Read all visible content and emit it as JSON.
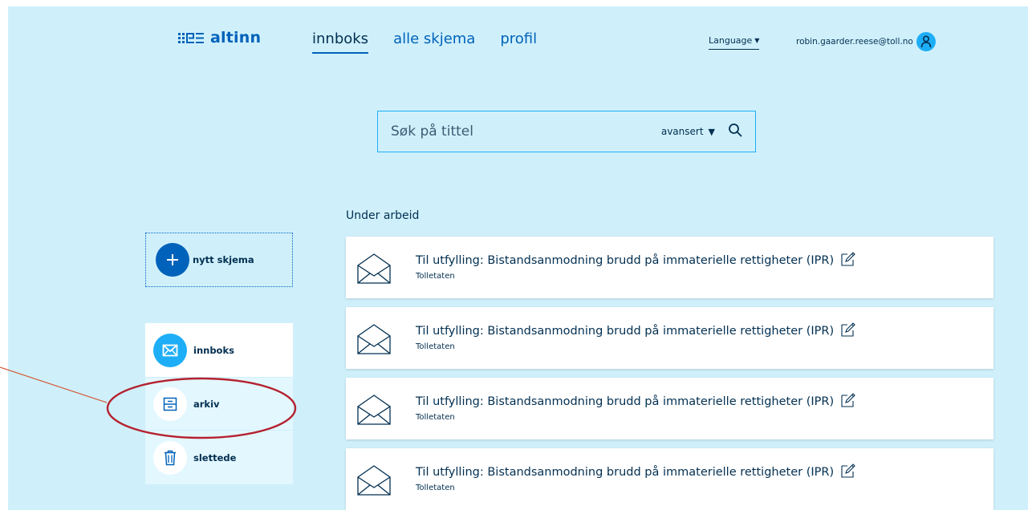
{
  "header": {
    "logo_text": "altinn",
    "nav": [
      {
        "label": "innboks",
        "active": true
      },
      {
        "label": "alle skjema",
        "active": false
      },
      {
        "label": "profil",
        "active": false
      }
    ],
    "language_label": "Language",
    "user_email": "robin.gaarder.reese@toll.no"
  },
  "search": {
    "placeholder": "Søk på tittel",
    "advanced_label": "avansert"
  },
  "sidebar": {
    "new_form_label": "nytt skjema",
    "items": [
      {
        "label": "innboks",
        "icon": "envelope-icon",
        "active": true
      },
      {
        "label": "arkiv",
        "icon": "archive-icon",
        "active": false
      },
      {
        "label": "slettede",
        "icon": "trash-icon",
        "active": false
      }
    ]
  },
  "main": {
    "section_title": "Under arbeid",
    "messages": [
      {
        "title": "Til utfylling: Bistandsanmodning brudd på immaterielle rettigheter (IPR)",
        "sender": "Tolletaten"
      },
      {
        "title": "Til utfylling: Bistandsanmodning brudd på immaterielle rettigheter (IPR)",
        "sender": "Tolletaten"
      },
      {
        "title": "Til utfylling: Bistandsanmodning brudd på immaterielle rettigheter (IPR)",
        "sender": "Tolletaten"
      },
      {
        "title": "Til utfylling: Bistandsanmodning brudd på immaterielle rettigheter (IPR)",
        "sender": "Tolletaten"
      }
    ]
  },
  "colors": {
    "background": "#cff0fb",
    "primary": "#0062ba",
    "accent": "#1eaef7",
    "text": "#022f51",
    "annotation": "#c0392b"
  }
}
